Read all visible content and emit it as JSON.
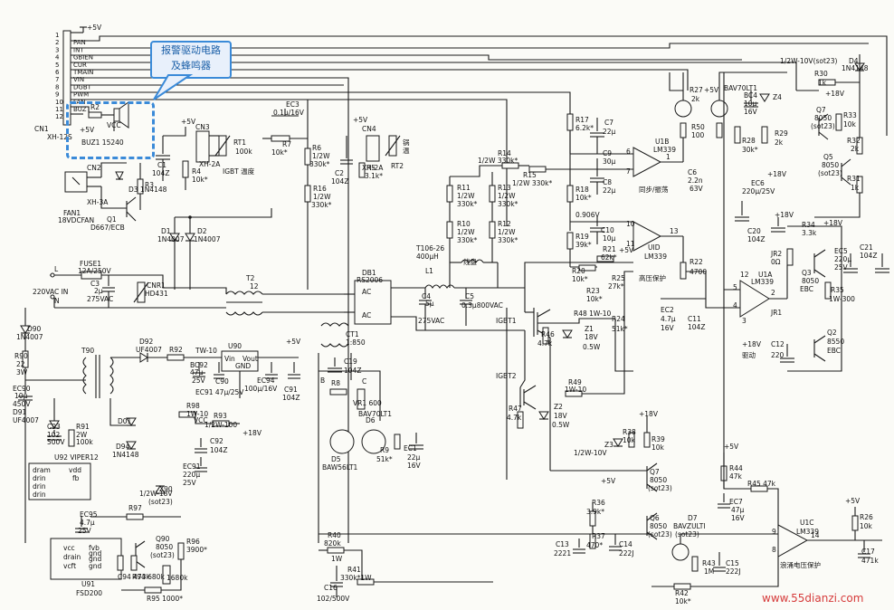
{
  "callout": {
    "line1": "报警驱动电路",
    "line2": "及蜂鸣器"
  },
  "watermark": "www.55dianzi.com",
  "connector_cn1": {
    "name": "CN1",
    "part": "XH-12S",
    "supply": "+5V",
    "pins": [
      {
        "num": "1",
        "sig": ""
      },
      {
        "num": "2",
        "sig": "PAN"
      },
      {
        "num": "3",
        "sig": "INT"
      },
      {
        "num": "4",
        "sig": "GBIEN"
      },
      {
        "num": "5",
        "sig": "CUR"
      },
      {
        "num": "6",
        "sig": "TMAIN"
      },
      {
        "num": "7",
        "sig": "VIN"
      },
      {
        "num": "8",
        "sig": "DGBT"
      },
      {
        "num": "9",
        "sig": "PWM"
      },
      {
        "num": "10",
        "sig": "FAN"
      },
      {
        "num": "11",
        "sig": "BUZ"
      },
      {
        "num": "12",
        "sig": ""
      }
    ]
  },
  "labels": [
    {
      "id": "r2",
      "t": "R2"
    },
    {
      "id": "p5v_buz",
      "t": "+5V"
    },
    {
      "id": "vcc_buz",
      "t": "VCC"
    },
    {
      "id": "buz",
      "t": "BUZ1 15240"
    },
    {
      "id": "cn2",
      "t": "CN2"
    },
    {
      "id": "xh3a",
      "t": "XH-3A"
    },
    {
      "id": "fan1",
      "t": "FAN1"
    },
    {
      "id": "fan1b",
      "t": "18VDCFAN"
    },
    {
      "id": "d3",
      "t": "D3 1N4148"
    },
    {
      "id": "r3",
      "t": "R3"
    },
    {
      "id": "q1",
      "t": "Q1"
    },
    {
      "id": "q1b",
      "t": "D667/ECB"
    },
    {
      "id": "c1",
      "t": "C1"
    },
    {
      "id": "c1v",
      "t": "104Z"
    },
    {
      "id": "cn3",
      "t": "CN3"
    },
    {
      "id": "cn3p",
      "t": "XH-2A"
    },
    {
      "id": "p5v_cn3",
      "t": "+5V"
    },
    {
      "id": "r4",
      "t": "R4"
    },
    {
      "id": "r4v",
      "t": "10k*"
    },
    {
      "id": "rt1",
      "t": "RT1"
    },
    {
      "id": "rt1v",
      "t": "100k"
    },
    {
      "id": "igbtwd",
      "t": "IGBT 温度"
    },
    {
      "id": "ec3",
      "t": "EC3"
    },
    {
      "id": "ec3v",
      "t": "0.1µ/16V"
    },
    {
      "id": "r7",
      "t": "R7"
    },
    {
      "id": "r7v",
      "t": "10k*"
    },
    {
      "id": "r6",
      "t": "R6"
    },
    {
      "id": "r6v",
      "t": "1/2W"
    },
    {
      "id": "r6v2",
      "t": "330k*"
    },
    {
      "id": "r16",
      "t": "R16"
    },
    {
      "id": "r16v",
      "t": "1/2W"
    },
    {
      "id": "r16v2",
      "t": "330k*"
    },
    {
      "id": "cn4",
      "t": "CN4"
    },
    {
      "id": "cn4p",
      "t": "XH-2A"
    },
    {
      "id": "p5v_cn4",
      "t": "+5V"
    },
    {
      "id": "c2",
      "t": "C2"
    },
    {
      "id": "c2v",
      "t": "104Z"
    },
    {
      "id": "r5",
      "t": "R5"
    },
    {
      "id": "r5v",
      "t": "3.1k*"
    },
    {
      "id": "rt2",
      "t": "RT2"
    },
    {
      "id": "gwen",
      "t": "锅"
    },
    {
      "id": "gwen2",
      "t": "温"
    },
    {
      "id": "d1",
      "t": "D1"
    },
    {
      "id": "d1v",
      "t": "1N4007"
    },
    {
      "id": "d2",
      "t": "D2"
    },
    {
      "id": "d2v",
      "t": "1N4007"
    },
    {
      "id": "fuse",
      "t": "FUSE1"
    },
    {
      "id": "fusev",
      "t": "12A/250V"
    },
    {
      "id": "lterm",
      "t": "L"
    },
    {
      "id": "nterm",
      "t": "N"
    },
    {
      "id": "ac220",
      "t": "220VAC IN"
    },
    {
      "id": "c3",
      "t": "C3"
    },
    {
      "id": "c3v",
      "t": "2µ"
    },
    {
      "id": "c3v2",
      "t": "275VAC"
    },
    {
      "id": "cnr1",
      "t": "CNR1"
    },
    {
      "id": "cnr1v",
      "t": "HD431"
    },
    {
      "id": "t2",
      "t": "T2"
    },
    {
      "id": "t2v",
      "t": "12"
    },
    {
      "id": "db1",
      "t": "DB1"
    },
    {
      "id": "db1v",
      "t": "RS2006"
    },
    {
      "id": "ac1",
      "t": "AC"
    },
    {
      "id": "ac2",
      "t": "AC"
    },
    {
      "id": "t106",
      "t": "T106-26"
    },
    {
      "id": "t106v",
      "t": "400µH"
    },
    {
      "id": "l1",
      "t": "L1"
    },
    {
      "id": "c4",
      "t": "C4"
    },
    {
      "id": "c4v",
      "t": "5µ"
    },
    {
      "id": "c4v2",
      "t": "275VAC"
    },
    {
      "id": "c5",
      "t": "C5"
    },
    {
      "id": "c5v",
      "t": "0.3µ800VAC"
    },
    {
      "id": "xianpan",
      "t": "线盘"
    },
    {
      "id": "r11",
      "t": "R11"
    },
    {
      "id": "r11v",
      "t": "1/2W"
    },
    {
      "id": "r11v2",
      "t": "330k*"
    },
    {
      "id": "r10",
      "t": "R10"
    },
    {
      "id": "r10v",
      "t": "1/2W"
    },
    {
      "id": "r10v2",
      "t": "330k*"
    },
    {
      "id": "r13",
      "t": "R13"
    },
    {
      "id": "r13v",
      "t": "1/2W"
    },
    {
      "id": "r13v2",
      "t": "330k*"
    },
    {
      "id": "r12",
      "t": "R12"
    },
    {
      "id": "r12v",
      "t": "1/2W"
    },
    {
      "id": "r12v2",
      "t": "330k*"
    },
    {
      "id": "r14",
      "t": "R14"
    },
    {
      "id": "r14v",
      "t": "1/2W 330k*"
    },
    {
      "id": "r15",
      "t": "R15"
    },
    {
      "id": "r15v",
      "t": "1/2W 330k*"
    },
    {
      "id": "r17",
      "t": "R17"
    },
    {
      "id": "r17v",
      "t": "6.2k*"
    },
    {
      "id": "c7",
      "t": "C7"
    },
    {
      "id": "c7v",
      "t": "22µ"
    },
    {
      "id": "c9",
      "t": "C9"
    },
    {
      "id": "c9v",
      "t": "30µ"
    },
    {
      "id": "c8",
      "t": "C8"
    },
    {
      "id": "c8v",
      "t": "22µ"
    },
    {
      "id": "r18",
      "t": "R18"
    },
    {
      "id": "r18v",
      "t": "10k*"
    },
    {
      "id": "v0906",
      "t": "0.906V"
    },
    {
      "id": "r19",
      "t": "R19"
    },
    {
      "id": "r19v",
      "t": "39k*"
    },
    {
      "id": "c10",
      "t": "C10"
    },
    {
      "id": "c10v",
      "t": "10µ"
    },
    {
      "id": "r21",
      "t": "R21"
    },
    {
      "id": "r21v",
      "t": "62k*"
    },
    {
      "id": "p5v_r21",
      "t": "+5V"
    },
    {
      "id": "r20",
      "t": "R20"
    },
    {
      "id": "r20v",
      "t": "10k*"
    },
    {
      "id": "r23",
      "t": "R23"
    },
    {
      "id": "r23v",
      "t": "10k*"
    },
    {
      "id": "r25",
      "t": "R25"
    },
    {
      "id": "r25v",
      "t": "27k*"
    },
    {
      "id": "gybh",
      "t": "高压保护"
    },
    {
      "id": "r22",
      "t": "R22"
    },
    {
      "id": "r22v",
      "t": "4700"
    },
    {
      "id": "u1d",
      "t": "UID"
    },
    {
      "id": "u1dv",
      "t": "LM339"
    },
    {
      "id": "r24",
      "t": "R24"
    },
    {
      "id": "r24v",
      "t": "51k*"
    },
    {
      "id": "ec2",
      "t": "EC2"
    },
    {
      "id": "ec2v",
      "t": "4.7µ"
    },
    {
      "id": "ec2v2",
      "t": "16V"
    },
    {
      "id": "c11",
      "t": "C11"
    },
    {
      "id": "c11v",
      "t": "104Z"
    },
    {
      "id": "u1b",
      "t": "U1B"
    },
    {
      "id": "u1bv",
      "t": "LM339"
    },
    {
      "id": "tbjd",
      "t": "同步/振荡"
    },
    {
      "id": "r50",
      "t": "R50"
    },
    {
      "id": "r50v",
      "t": "100"
    },
    {
      "id": "c6",
      "t": "C6"
    },
    {
      "id": "c6v",
      "t": "2.2n"
    },
    {
      "id": "c6v2",
      "t": "63V"
    },
    {
      "id": "r27",
      "t": "R27"
    },
    {
      "id": "r27v",
      "t": "2k"
    },
    {
      "id": "p5v_r27",
      "t": "+5V"
    },
    {
      "id": "bav",
      "t": "BAV70LT1"
    },
    {
      "id": "r28",
      "t": "R28"
    },
    {
      "id": "r28v",
      "t": "30k*"
    },
    {
      "id": "bc4",
      "t": "BC4"
    },
    {
      "id": "bc4v",
      "t": "10µ"
    },
    {
      "id": "bc4v2",
      "t": "16V"
    },
    {
      "id": "z4",
      "t": "Z4"
    },
    {
      "id": "z4v",
      "t": "1/2W-10V(sot23)"
    },
    {
      "id": "r29",
      "t": "R29"
    },
    {
      "id": "r29v",
      "t": "2k"
    },
    {
      "id": "p18v_r29",
      "t": "+18V"
    },
    {
      "id": "r30",
      "t": "R30"
    },
    {
      "id": "r30v",
      "t": "1k"
    },
    {
      "id": "d4",
      "t": "D4"
    },
    {
      "id": "d4v",
      "t": "1N4148"
    },
    {
      "id": "p18v_r30",
      "t": "+18V"
    },
    {
      "id": "q7r",
      "t": "Q7"
    },
    {
      "id": "q7rv",
      "t": "8050"
    },
    {
      "id": "q7rv2",
      "t": "(sot23)"
    },
    {
      "id": "r33",
      "t": "R33"
    },
    {
      "id": "r33v",
      "t": "10k"
    },
    {
      "id": "r32",
      "t": "R32"
    },
    {
      "id": "r32v",
      "t": "2k"
    },
    {
      "id": "q5",
      "t": "Q5"
    },
    {
      "id": "q5v",
      "t": "8050"
    },
    {
      "id": "q5v2",
      "t": "(sot23)"
    },
    {
      "id": "r31",
      "t": "R31"
    },
    {
      "id": "r31v",
      "t": "1k"
    },
    {
      "id": "ec6",
      "t": "EC6"
    },
    {
      "id": "ec6v",
      "t": "220µ/25V"
    },
    {
      "id": "c20",
      "t": "C20"
    },
    {
      "id": "c20v",
      "t": "104Z"
    },
    {
      "id": "p18v_ec6",
      "t": "+18V"
    },
    {
      "id": "r34",
      "t": "R34"
    },
    {
      "id": "r34v",
      "t": "3.3k"
    },
    {
      "id": "p18v_r34",
      "t": "+18V"
    },
    {
      "id": "ec5",
      "t": "EC5"
    },
    {
      "id": "ec5v",
      "t": "220µ"
    },
    {
      "id": "ec5v2",
      "t": "25V"
    },
    {
      "id": "c21",
      "t": "C21"
    },
    {
      "id": "c21v",
      "t": "104Z"
    },
    {
      "id": "jr2",
      "t": "JR2"
    },
    {
      "id": "jr2v",
      "t": "0Ω"
    },
    {
      "id": "u1a",
      "t": "U1A"
    },
    {
      "id": "u1av",
      "t": "LM339"
    },
    {
      "id": "q3",
      "t": "Q3"
    },
    {
      "id": "q3v",
      "t": "8050"
    },
    {
      "id": "q3v2",
      "t": "EBC"
    },
    {
      "id": "r35",
      "t": "R35"
    },
    {
      "id": "r35v",
      "t": "1W-300"
    },
    {
      "id": "jr1",
      "t": "JR1"
    },
    {
      "id": "qudong",
      "t": "驱动"
    },
    {
      "id": "p18v_u1a",
      "t": "+18V"
    },
    {
      "id": "c12",
      "t": "C12"
    },
    {
      "id": "c12v",
      "t": "220"
    },
    {
      "id": "q2",
      "t": "Q2"
    },
    {
      "id": "q2v",
      "t": "8550"
    },
    {
      "id": "q2v2",
      "t": "EBC"
    },
    {
      "id": "igbt1",
      "t": "IGBT1"
    },
    {
      "id": "r48",
      "t": "R48 1W-10"
    },
    {
      "id": "r46",
      "t": "R46"
    },
    {
      "id": "r46v",
      "t": "4.7k"
    },
    {
      "id": "z1",
      "t": "Z1"
    },
    {
      "id": "z1v",
      "t": "18V"
    },
    {
      "id": "z1v2",
      "t": "0.5W"
    },
    {
      "id": "igbt2",
      "t": "IGBT2"
    },
    {
      "id": "r49",
      "t": "R49"
    },
    {
      "id": "r49v",
      "t": "1W-10"
    },
    {
      "id": "r47",
      "t": "R47"
    },
    {
      "id": "r47v",
      "t": "4.7k"
    },
    {
      "id": "z2",
      "t": "Z2"
    },
    {
      "id": "z2v",
      "t": "18V"
    },
    {
      "id": "z2v2",
      "t": "0.5W"
    },
    {
      "id": "ct1",
      "t": "CT1"
    },
    {
      "id": "ct1v",
      "t": "1:850"
    },
    {
      "id": "c19",
      "t": "C19"
    },
    {
      "id": "c19v",
      "t": "104Z"
    },
    {
      "id": "bpin",
      "t": "B"
    },
    {
      "id": "cpin",
      "t": "C"
    },
    {
      "id": "r8",
      "t": "R8"
    },
    {
      "id": "vr1",
      "t": "VR1 600"
    },
    {
      "id": "d6",
      "t": "D6"
    },
    {
      "id": "d6v",
      "t": "BAV70LT1"
    },
    {
      "id": "d5",
      "t": "D5"
    },
    {
      "id": "d5v",
      "t": "BAW56LT1"
    },
    {
      "id": "r9",
      "t": "R9"
    },
    {
      "id": "r9v",
      "t": "51k*"
    },
    {
      "id": "ec1",
      "t": "EC1"
    },
    {
      "id": "ec1v",
      "t": "22µ"
    },
    {
      "id": "ec1v2",
      "t": "16V"
    },
    {
      "id": "d90",
      "t": "D90"
    },
    {
      "id": "d90v",
      "t": "1N4007"
    },
    {
      "id": "r90",
      "t": "R90"
    },
    {
      "id": "r90v",
      "t": "22"
    },
    {
      "id": "r90v2",
      "t": "3W"
    },
    {
      "id": "t90",
      "t": "T90"
    },
    {
      "id": "d92",
      "t": "D92"
    },
    {
      "id": "d92v",
      "t": "UF4007"
    },
    {
      "id": "r92",
      "t": "R92"
    },
    {
      "id": "tw10",
      "t": "TW-10"
    },
    {
      "id": "u90",
      "t": "U90"
    },
    {
      "id": "u90a",
      "t": "Vin"
    },
    {
      "id": "u90b",
      "t": "Vout"
    },
    {
      "id": "u90c",
      "t": "GND"
    },
    {
      "id": "p5v_u90",
      "t": "+5V"
    },
    {
      "id": "bc92",
      "t": "BC92"
    },
    {
      "id": "bc92v",
      "t": "47µ"
    },
    {
      "id": "bc92v2",
      "t": "25V"
    },
    {
      "id": "c90",
      "t": "C90"
    },
    {
      "id": "ec94",
      "t": "EC94"
    },
    {
      "id": "ec94v",
      "t": "100µ/16V"
    },
    {
      "id": "c91",
      "t": "C91"
    },
    {
      "id": "c91v",
      "t": "104Z"
    },
    {
      "id": "ec91",
      "t": "EC91 47µ/25V"
    },
    {
      "id": "ec90",
      "t": "EC90"
    },
    {
      "id": "ec90v",
      "t": "10µ"
    },
    {
      "id": "ec90v2",
      "t": "450V"
    },
    {
      "id": "d91",
      "t": "D91"
    },
    {
      "id": "d91v",
      "t": "UF4007"
    },
    {
      "id": "c93",
      "t": "C93"
    },
    {
      "id": "c93v",
      "t": "102"
    },
    {
      "id": "c93v2",
      "t": "500V"
    },
    {
      "id": "r91",
      "t": "R91"
    },
    {
      "id": "r91v",
      "t": "2W"
    },
    {
      "id": "r91v2",
      "t": "100k"
    },
    {
      "id": "r98",
      "t": "R98"
    },
    {
      "id": "r98v",
      "t": "1W-10"
    },
    {
      "id": "vcc_r98",
      "t": "VCC"
    },
    {
      "id": "r93",
      "t": "R93"
    },
    {
      "id": "r93v",
      "t": "1/2W-100"
    },
    {
      "id": "p18v_r93",
      "t": "+18V"
    },
    {
      "id": "d01",
      "t": "D01"
    },
    {
      "id": "c92",
      "t": "C92"
    },
    {
      "id": "c92v",
      "t": "104Z"
    },
    {
      "id": "d94",
      "t": "D94"
    },
    {
      "id": "d94v",
      "t": "1N4148"
    },
    {
      "id": "u92",
      "t": "U92 VIPER12"
    },
    {
      "id": "u92a",
      "t": "dram"
    },
    {
      "id": "u92b",
      "t": "vdd"
    },
    {
      "id": "u92c",
      "t": "drin"
    },
    {
      "id": "u92d",
      "t": "fb"
    },
    {
      "id": "u92e",
      "t": "drin"
    },
    {
      "id": "u92f",
      "t": "drin"
    },
    {
      "id": "ec91b",
      "t": "EC91"
    },
    {
      "id": "ec91bv",
      "t": "220µ"
    },
    {
      "id": "ec91bv2",
      "t": "25V"
    },
    {
      "id": "z90",
      "t": "Z90"
    },
    {
      "id": "z90v",
      "t": "1/2W-18V"
    },
    {
      "id": "z90v2",
      "t": "(sot23)"
    },
    {
      "id": "ec95",
      "t": "EC95"
    },
    {
      "id": "ec95v",
      "t": "4.7µ"
    },
    {
      "id": "ec95v2",
      "t": "25V"
    },
    {
      "id": "r97",
      "t": "R97"
    },
    {
      "id": "q90",
      "t": "Q90"
    },
    {
      "id": "q90v",
      "t": "8050"
    },
    {
      "id": "q90v2",
      "t": "(sot23)"
    },
    {
      "id": "r96",
      "t": "R96"
    },
    {
      "id": "r96v",
      "t": "3900*"
    },
    {
      "id": "u91a",
      "t": "vcc"
    },
    {
      "id": "u91b",
      "t": "drain"
    },
    {
      "id": "u91c",
      "t": "vcft"
    },
    {
      "id": "u91d",
      "t": "fvb"
    },
    {
      "id": "u91e",
      "t": "gnd"
    },
    {
      "id": "u91f",
      "t": "gnd"
    },
    {
      "id": "u91g",
      "t": "gnd"
    },
    {
      "id": "u91",
      "t": "U91"
    },
    {
      "id": "u91v",
      "t": "FSD200"
    },
    {
      "id": "c94",
      "t": "C94 473k"
    },
    {
      "id": "r94",
      "t": "R94 680k"
    },
    {
      "id": "r95",
      "t": "R95 1000*"
    },
    {
      "id": "r1680",
      "t": "1680k"
    },
    {
      "id": "r40",
      "t": "R40"
    },
    {
      "id": "r40v",
      "t": "820k"
    },
    {
      "id": "r40v2",
      "t": "1W"
    },
    {
      "id": "r41",
      "t": "R41"
    },
    {
      "id": "r41v",
      "t": "330k*1W"
    },
    {
      "id": "c16",
      "t": "C16"
    },
    {
      "id": "c16v",
      "t": "102/500V"
    },
    {
      "id": "z3",
      "t": "Z3"
    },
    {
      "id": "z3v",
      "t": "1/2W-10V"
    },
    {
      "id": "r38",
      "t": "R38"
    },
    {
      "id": "r38v",
      "t": "10k"
    },
    {
      "id": "r39",
      "t": "R39"
    },
    {
      "id": "r39v",
      "t": "10k"
    },
    {
      "id": "p18v_r39",
      "t": "+18V"
    },
    {
      "id": "q7",
      "t": "Q7"
    },
    {
      "id": "q7v",
      "t": "8050"
    },
    {
      "id": "q7v2",
      "t": "(sot23)"
    },
    {
      "id": "p5v_r36",
      "t": "+5V"
    },
    {
      "id": "r36",
      "t": "R36"
    },
    {
      "id": "r36v",
      "t": "3.9k*"
    },
    {
      "id": "q6",
      "t": "Q6"
    },
    {
      "id": "q6v",
      "t": "8050"
    },
    {
      "id": "q6v2",
      "t": "(sot23)"
    },
    {
      "id": "r37",
      "t": "R37"
    },
    {
      "id": "r37v",
      "t": "470*"
    },
    {
      "id": "c13",
      "t": "C13"
    },
    {
      "id": "c13v",
      "t": "2221"
    },
    {
      "id": "c14",
      "t": "C14"
    },
    {
      "id": "c14v",
      "t": "222J"
    },
    {
      "id": "d7",
      "t": "D7"
    },
    {
      "id": "d7v",
      "t": "BAVZULTI"
    },
    {
      "id": "d7v2",
      "t": "(sot23)"
    },
    {
      "id": "r43",
      "t": "R43"
    },
    {
      "id": "r43v",
      "t": "1M"
    },
    {
      "id": "c15",
      "t": "C15"
    },
    {
      "id": "c15v",
      "t": "222J"
    },
    {
      "id": "r42",
      "t": "R42"
    },
    {
      "id": "r42v",
      "t": "10k*"
    },
    {
      "id": "p5v_r44",
      "t": "+5V"
    },
    {
      "id": "r44",
      "t": "R44"
    },
    {
      "id": "r44v",
      "t": "47k"
    },
    {
      "id": "r45",
      "t": "R45 47k"
    },
    {
      "id": "ec7",
      "t": "EC7"
    },
    {
      "id": "ec7v",
      "t": "47µ"
    },
    {
      "id": "ec7v2",
      "t": "16V"
    },
    {
      "id": "u1c",
      "t": "U1C"
    },
    {
      "id": "u1cv",
      "t": "LM339"
    },
    {
      "id": "sdbh",
      "t": "浪涌电压保护"
    },
    {
      "id": "p5v_r26",
      "t": "+5V"
    },
    {
      "id": "r26",
      "t": "R26"
    },
    {
      "id": "r26v",
      "t": "10k"
    },
    {
      "id": "c17",
      "t": "C17"
    },
    {
      "id": "c17v",
      "t": "471k"
    },
    {
      "id": "pin9",
      "t": "9"
    },
    {
      "id": "pin8",
      "t": "8"
    },
    {
      "id": "pin14",
      "t": "14"
    },
    {
      "id": "pin6",
      "t": "6"
    },
    {
      "id": "pin7",
      "t": "7"
    },
    {
      "id": "pin1",
      "t": "1"
    },
    {
      "id": "pin10",
      "t": "10"
    },
    {
      "id": "pin11",
      "t": "11"
    },
    {
      "id": "pin13",
      "t": "13"
    },
    {
      "id": "pin12",
      "t": "12"
    },
    {
      "id": "pin5",
      "t": "5"
    },
    {
      "id": "pin4",
      "t": "4"
    },
    {
      "id": "pin2",
      "t": "2"
    },
    {
      "id": "pin3",
      "t": "3"
    }
  ]
}
